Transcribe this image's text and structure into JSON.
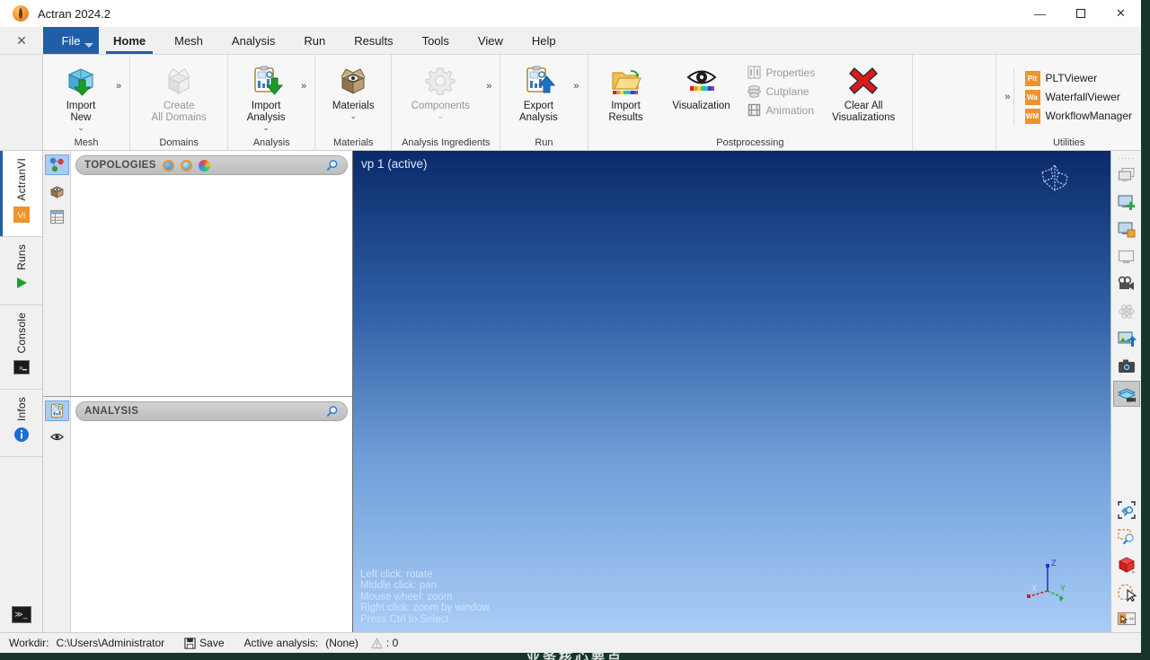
{
  "window": {
    "title": "Actran 2024.2",
    "app_icon": "actran-logo-icon",
    "minimize": "—",
    "maximize": "☐",
    "close": "✕"
  },
  "menubar": {
    "close_stub": "✕",
    "file_label": "File",
    "items": [
      {
        "label": "Home",
        "active": true
      },
      {
        "label": "Mesh",
        "active": false
      },
      {
        "label": "Analysis",
        "active": false
      },
      {
        "label": "Run",
        "active": false
      },
      {
        "label": "Results",
        "active": false
      },
      {
        "label": "Tools",
        "active": false
      },
      {
        "label": "View",
        "active": false
      },
      {
        "label": "Help",
        "active": false
      }
    ]
  },
  "ribbon": {
    "expand_glyph": "»",
    "chevron_glyph": "⌄",
    "groups": [
      {
        "name": "Mesh",
        "label": "Mesh",
        "buttons": [
          {
            "name": "import-new",
            "label": "Import\nNew",
            "icon": "import-mesh-icon",
            "disabled": false,
            "has_chevron": true
          }
        ],
        "expander": true
      },
      {
        "name": "Domains",
        "label": "Domains",
        "buttons": [
          {
            "name": "create-all-domains",
            "label": "Create\nAll Domains",
            "icon": "open-box-icon",
            "disabled": true,
            "has_chevron": false
          }
        ],
        "expander": false
      },
      {
        "name": "Analysis",
        "label": "Analysis",
        "buttons": [
          {
            "name": "import-analysis",
            "label": "Import\nAnalysis",
            "icon": "import-analysis-icon",
            "disabled": false,
            "has_chevron": true
          }
        ],
        "expander": true
      },
      {
        "name": "Materials",
        "label": "Materials",
        "buttons": [
          {
            "name": "materials",
            "label": "Materials",
            "icon": "materials-box-icon",
            "disabled": false,
            "has_chevron": true
          }
        ],
        "expander": false
      },
      {
        "name": "Analysis Ingredients",
        "label": "Analysis Ingredients",
        "buttons": [
          {
            "name": "components",
            "label": "Components",
            "icon": "gear-icon",
            "disabled": true,
            "has_chevron": true
          }
        ],
        "expander": true
      },
      {
        "name": "Run",
        "label": "Run",
        "buttons": [
          {
            "name": "export-analysis",
            "label": "Export\nAnalysis",
            "icon": "export-analysis-icon",
            "disabled": false,
            "has_chevron": false
          }
        ],
        "expander": true
      },
      {
        "name": "Postprocessing",
        "label": "Postprocessing",
        "buttons": [
          {
            "name": "import-results",
            "label": "Import\nResults",
            "icon": "import-results-folder-icon",
            "disabled": false,
            "has_chevron": false
          },
          {
            "name": "visualization",
            "label": "Visualization",
            "icon": "eye-icon",
            "disabled": false,
            "has_chevron": false
          }
        ],
        "small_buttons": [
          {
            "name": "properties",
            "label": "Properties",
            "icon": "properties-icon",
            "disabled": true
          },
          {
            "name": "cutplane",
            "label": "Cutplane",
            "icon": "cutplane-icon",
            "disabled": true
          },
          {
            "name": "animation",
            "label": "Animation",
            "icon": "animation-icon",
            "disabled": true
          }
        ],
        "big_button": {
          "name": "clear-all-visualizations",
          "label": "Clear All\nVisualizations",
          "icon": "red-cross-icon",
          "disabled": false
        },
        "expander": false
      },
      {
        "name": "Utilities",
        "label": "Utilities",
        "rows": [
          {
            "name": "pltviewer",
            "badge": "Plt",
            "label": "PLTViewer"
          },
          {
            "name": "waterfallviewer",
            "badge": "Wa",
            "label": "WaterfallViewer"
          },
          {
            "name": "workflowmanager",
            "badge": "WM",
            "label": "WorkflowManager"
          }
        ],
        "expander": true
      }
    ]
  },
  "rail": {
    "tabs": [
      {
        "name": "actranvi",
        "label": "ActranVI",
        "icon": "vi-badge-icon",
        "selected": true
      },
      {
        "name": "runs",
        "label": "Runs",
        "icon": "play-icon",
        "selected": false
      },
      {
        "name": "console",
        "label": "Console",
        "icon": "console-icon",
        "selected": false
      },
      {
        "name": "infos",
        "label": "Infos",
        "icon": "info-icon",
        "selected": false
      }
    ],
    "bottom_button": {
      "name": "console-toggle",
      "icon": "console-prompt-icon",
      "glyph": "≫_"
    }
  },
  "panels": {
    "topologies": {
      "title": "TOPOLOGIES",
      "search_icon": "search-icon",
      "header_icons": [
        "node-color-icon",
        "element-color-icon",
        "colormap-icon"
      ],
      "side_icons": [
        "topologies-icon",
        "materials-icon",
        "table-icon"
      ],
      "selected_side_icon": 0,
      "items": []
    },
    "analysis": {
      "title": "ANALYSIS",
      "search_icon": "search-icon",
      "side_icons": [
        "analysis-clipboard-icon",
        "visibility-icon"
      ],
      "selected_side_icon": 0,
      "items": []
    }
  },
  "viewport": {
    "label": "vp 1 (active)",
    "frustum_icon": "view-frustum-icon",
    "help_text": "Left click: rotate\nMiddle click: pan\nMouse wheel: zoom\nRight click: zoom by window\nPress Ctrl to Select",
    "triad": {
      "x_label": "X",
      "y_label": "Y",
      "z_label": "Z",
      "x_color": "#cc2222",
      "y_color": "#22aa33",
      "z_color": "#2233cc"
    },
    "bg_top": "#0a2a6b",
    "bg_bottom": "#a9ccf7"
  },
  "right_toolbar": {
    "grip": "·····",
    "buttons": [
      {
        "name": "viewports-layout",
        "icon": "multi-viewport-icon",
        "selected": false
      },
      {
        "name": "add-viewport",
        "icon": "add-viewport-icon",
        "selected": false
      },
      {
        "name": "viewport-settings",
        "icon": "viewport-settings-icon",
        "selected": false
      },
      {
        "name": "single-viewport",
        "icon": "single-viewport-icon",
        "selected": false
      },
      {
        "name": "record-movie",
        "icon": "movie-camera-icon",
        "selected": false
      },
      {
        "name": "animation-settings",
        "icon": "animation-atoms-icon",
        "selected": false
      },
      {
        "name": "export-image",
        "icon": "export-image-icon",
        "selected": false
      },
      {
        "name": "screenshot",
        "icon": "camera-icon",
        "selected": false
      },
      {
        "name": "cutplane-view",
        "icon": "cutplane-camera-icon",
        "selected": true
      },
      {
        "name": "zoom-selection",
        "icon": "zoom-selection-icon",
        "selected": false
      },
      {
        "name": "zoom-window",
        "icon": "zoom-window-icon",
        "selected": false
      },
      {
        "name": "box-select",
        "icon": "red-cube-icon",
        "selected": false
      },
      {
        "name": "lasso-select",
        "icon": "lasso-select-icon",
        "selected": false
      },
      {
        "name": "pick-mode",
        "icon": "pick-mode-icon",
        "selected": false
      }
    ]
  },
  "statusbar": {
    "workdir_label": "Workdir:",
    "workdir_value": "C:\\Users\\Administrator",
    "save_icon": "save-icon",
    "save_label": "Save",
    "active_analysis_label": "Active analysis:",
    "active_analysis_value": "(None)",
    "warning_icon": "warning-icon",
    "warning_count": ": 0"
  },
  "desktop": {
    "bleed_text": "业务核心要点"
  }
}
